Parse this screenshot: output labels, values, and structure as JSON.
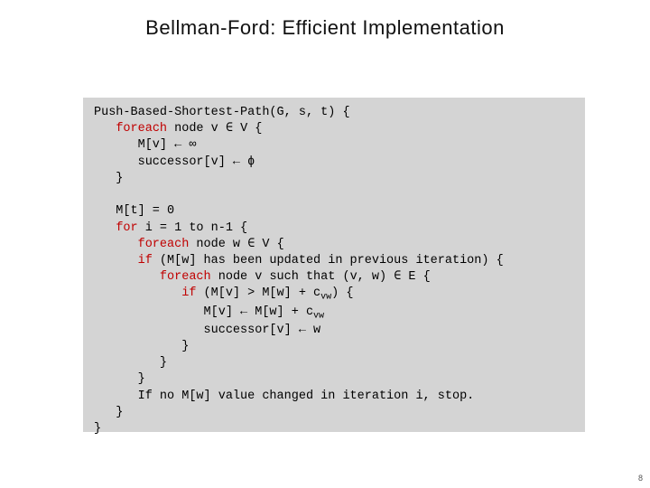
{
  "title": "Bellman-Ford: Efficient Implementation",
  "page_number": "8",
  "code": {
    "l01a": "Push-Based-Shortest-Path(G, s, t) {",
    "l02a": "   ",
    "l02k": "foreach",
    "l02b": " node v ∈ V {",
    "l03": "      M[v] ← ∞",
    "l04": "      successor[v] ← ϕ",
    "l05": "   }",
    "blank1": " ",
    "l06": "   M[t] = 0",
    "l07a": "   ",
    "l07k": "for",
    "l07b": " i = 1 to n-1 {",
    "l08a": "      ",
    "l08k": "foreach",
    "l08b": " node w ∈ V {",
    "l09a": "      ",
    "l09k": "if",
    "l09b": " (M[w] has been updated in previous iteration) {",
    "l10a": "         ",
    "l10k": "foreach",
    "l10b": " node v such that (v, w) ∈ E {",
    "l11a": "            ",
    "l11k": "if",
    "l11b": " (M[v] > M[w] + c",
    "l11sub": "vw",
    "l11c": ") {",
    "l12a": "               M[v] ← M[w] + c",
    "l12sub": "vw",
    "l13": "               successor[v] ← w",
    "l14": "            }",
    "l15": "         }",
    "l16": "      }",
    "l17a": "      If no M[w] value changed in iteration i, stop.",
    "l18": "   }",
    "l19": "}"
  }
}
